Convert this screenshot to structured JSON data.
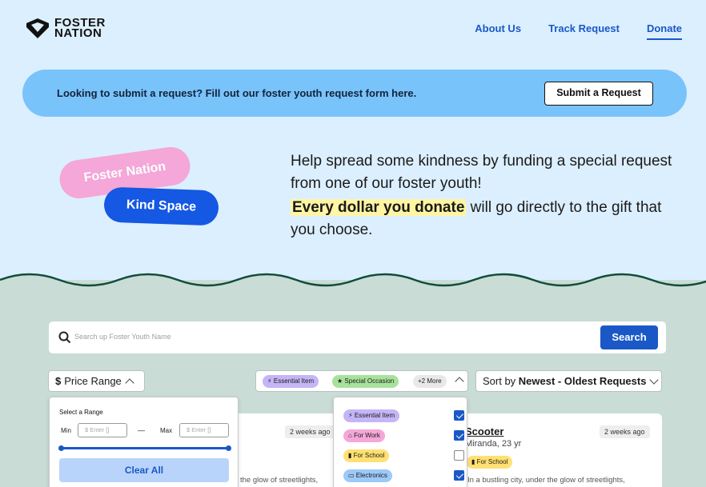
{
  "brand": {
    "line1": "FOSTER",
    "line2": "NATION"
  },
  "nav": {
    "about": "About Us",
    "track": "Track Request",
    "donate": "Donate"
  },
  "banner": {
    "text": "Looking to submit a request? Fill out our foster youth request form here.",
    "button": "Submit a Request"
  },
  "pills": {
    "foster_nation": "Foster Nation",
    "kind_space": "Kind Space"
  },
  "hero": {
    "line1": "Help spread some kindness by funding a special request from one of our foster youth!",
    "highlight": "Every dollar you donate",
    "line2_rest": " will go directly to the gift that you choose."
  },
  "search": {
    "placeholder": "Search up Foster Youth Name",
    "button": "Search"
  },
  "filters": {
    "price_symbol": "$",
    "price_label": "Price Range",
    "tags": [
      {
        "label": "Essential Item",
        "icon": "bolt-icon",
        "color": "#c4b5f7"
      },
      {
        "label": "Special Occasion",
        "icon": "star-icon",
        "color": "#a7e29b"
      },
      {
        "label": "+2 More",
        "color": "#e8e8e8"
      }
    ],
    "sort_prefix": "Sort by ",
    "sort_value": "Newest - Oldest Requests"
  },
  "price_panel": {
    "title": "Select a Range",
    "min_label": "Min",
    "max_label": "Max",
    "min_placeholder": "$ Enter []",
    "max_placeholder": "$ Enter []",
    "dash": "—",
    "slider_min_pct": 0,
    "slider_max_pct": 100,
    "clear": "Clear All"
  },
  "tag_panel": {
    "options": [
      {
        "label": "Essential Item",
        "icon": "bolt-icon",
        "color": "#c4b5f7",
        "checked": true
      },
      {
        "label": "For Work",
        "icon": "briefcase-icon",
        "color": "#f4a7d8",
        "checked": true
      },
      {
        "label": "For School",
        "icon": "book-icon",
        "color": "#ffe072",
        "checked": false
      },
      {
        "label": "Electronics",
        "icon": "monitor-icon",
        "color": "#9cc9f7",
        "checked": true
      }
    ]
  },
  "cards": [
    {
      "time": "2 weeks ago",
      "snippet": "the glow of streetlights,"
    },
    {
      "title": "Scooter",
      "subtitle": "Miranda, 23 yr",
      "tag": "For School",
      "tag_icon": "book-icon",
      "tag_color": "#ffe072",
      "time": "2 weeks ago",
      "snippet": "In a bustling city, under the glow of streetlights,"
    }
  ]
}
